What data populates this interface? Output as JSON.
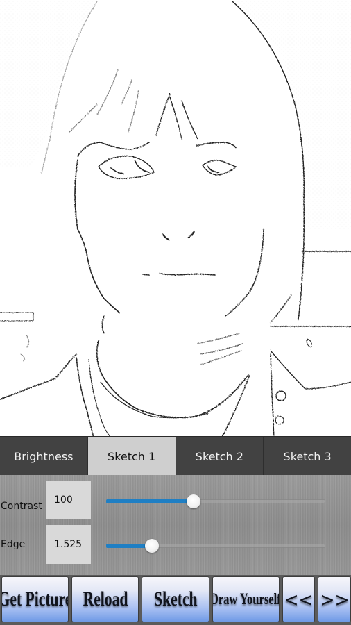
{
  "canvas": {
    "description": "Pencil sketch rendering of a portrait photo"
  },
  "tabs": [
    {
      "label": "Brightness",
      "active": false
    },
    {
      "label": "Sketch 1",
      "active": true
    },
    {
      "label": "Sketch 2",
      "active": false
    },
    {
      "label": "Sketch 3",
      "active": false
    }
  ],
  "controls": {
    "contrast": {
      "label": "Contrast",
      "value": "100",
      "slider_fraction": 0.4
    },
    "edge": {
      "label": "Edge",
      "value": "1.525",
      "slider_fraction": 0.21
    }
  },
  "buttons": {
    "get_picture": "Get Picture",
    "reload": "Reload",
    "sketch": "Sketch",
    "draw_yourself": "Draw Yourself",
    "prev": "<<",
    "next": ">>"
  },
  "colors": {
    "slider_accent": "#1f7fc4",
    "active_tab_bg": "#cfcfcf",
    "tab_bg": "#424242"
  }
}
